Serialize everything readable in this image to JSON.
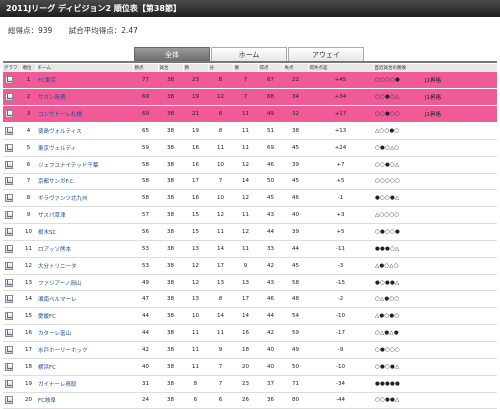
{
  "title": "2011Jリーグ ディビジョン2 順位表【第38節】",
  "summary": {
    "total_goals": "総得点：939",
    "avg_goals": "試合平均得点：2.47"
  },
  "tabs": [
    "全体",
    "ホーム",
    "アウェイ"
  ],
  "active_tab": 0,
  "columns": [
    "グラフ",
    "順位",
    "チーム",
    "勝点",
    "試合",
    "勝",
    "分",
    "敗",
    "得点",
    "失点",
    "得失点差",
    "直近試合の勝敗"
  ],
  "colors": {
    "promoted_row": "#f05a96",
    "title_bar": "#1f1f1f",
    "team_link": "#1a4fa0"
  },
  "rows": [
    {
      "rank": "1",
      "team": "FC東京",
      "pts": "77",
      "games": "38",
      "w": "23",
      "d": "8",
      "l": "7",
      "gf": "67",
      "ga": "22",
      "gd": "+45",
      "form": "○○○○●",
      "status": "J1昇格",
      "promoted": true
    },
    {
      "rank": "2",
      "team": "サガン鳥栖",
      "pts": "69",
      "games": "38",
      "w": "19",
      "d": "12",
      "l": "7",
      "gf": "68",
      "ga": "34",
      "gd": "+34",
      "form": "○○●○△",
      "status": "J1昇格",
      "promoted": true
    },
    {
      "rank": "3",
      "team": "コンサドーレ札幌",
      "pts": "69",
      "games": "38",
      "w": "21",
      "d": "6",
      "l": "11",
      "gf": "49",
      "ga": "32",
      "gd": "+17",
      "form": "○○●○○",
      "status": "J1昇格",
      "promoted": true
    },
    {
      "rank": "4",
      "team": "徳島ヴォルティス",
      "pts": "65",
      "games": "38",
      "w": "19",
      "d": "8",
      "l": "11",
      "gf": "51",
      "ga": "38",
      "gd": "+13",
      "form": "△○○●○",
      "status": "",
      "promoted": false
    },
    {
      "rank": "5",
      "team": "東京ヴェルディ",
      "pts": "59",
      "games": "38",
      "w": "16",
      "d": "11",
      "l": "11",
      "gf": "69",
      "ga": "45",
      "gd": "+24",
      "form": "○●○△○",
      "status": "",
      "promoted": false
    },
    {
      "rank": "6",
      "team": "ジェフユナイテッド千葉",
      "pts": "58",
      "games": "38",
      "w": "16",
      "d": "10",
      "l": "12",
      "gf": "46",
      "ga": "39",
      "gd": "+7",
      "form": "○○●○△",
      "status": "",
      "promoted": false
    },
    {
      "rank": "7",
      "team": "京都サンガF.C.",
      "pts": "58",
      "games": "38",
      "w": "17",
      "d": "7",
      "l": "14",
      "gf": "50",
      "ga": "45",
      "gd": "+5",
      "form": "○○○○○",
      "status": "",
      "promoted": false
    },
    {
      "rank": "8",
      "team": "ギラヴァンツ北九州",
      "pts": "58",
      "games": "38",
      "w": "16",
      "d": "10",
      "l": "12",
      "gf": "45",
      "ga": "46",
      "gd": "-1",
      "form": "●○○●△",
      "status": "",
      "promoted": false
    },
    {
      "rank": "9",
      "team": "ザスパ草津",
      "pts": "57",
      "games": "38",
      "w": "15",
      "d": "12",
      "l": "11",
      "gf": "43",
      "ga": "40",
      "gd": "+3",
      "form": "△○○○○",
      "status": "",
      "promoted": false
    },
    {
      "rank": "10",
      "team": "栃木SC",
      "pts": "56",
      "games": "38",
      "w": "15",
      "d": "11",
      "l": "12",
      "gf": "44",
      "ga": "39",
      "gd": "+5",
      "form": "○●○○●",
      "status": "",
      "promoted": false
    },
    {
      "rank": "11",
      "team": "ロアッソ熊本",
      "pts": "53",
      "games": "38",
      "w": "13",
      "d": "14",
      "l": "11",
      "gf": "33",
      "ga": "44",
      "gd": "-11",
      "form": "●●●○△",
      "status": "",
      "promoted": false
    },
    {
      "rank": "12",
      "team": "大分トリニータ",
      "pts": "53",
      "games": "38",
      "w": "12",
      "d": "17",
      "l": "9",
      "gf": "42",
      "ga": "45",
      "gd": "-3",
      "form": "△●○△○",
      "status": "",
      "promoted": false
    },
    {
      "rank": "13",
      "team": "ファジアーノ岡山",
      "pts": "49",
      "games": "38",
      "w": "12",
      "d": "13",
      "l": "13",
      "gf": "43",
      "ga": "58",
      "gd": "-15",
      "form": "●○●●△",
      "status": "",
      "promoted": false
    },
    {
      "rank": "14",
      "team": "湘南ベルマーレ",
      "pts": "47",
      "games": "38",
      "w": "13",
      "d": "8",
      "l": "17",
      "gf": "46",
      "ga": "48",
      "gd": "-2",
      "form": "○△●○○",
      "status": "",
      "promoted": false
    },
    {
      "rank": "15",
      "team": "愛媛FC",
      "pts": "44",
      "games": "38",
      "w": "10",
      "d": "14",
      "l": "14",
      "gf": "44",
      "ga": "54",
      "gd": "-10",
      "form": "△●○●○",
      "status": "",
      "promoted": false
    },
    {
      "rank": "16",
      "team": "カターレ富山",
      "pts": "44",
      "games": "38",
      "w": "11",
      "d": "11",
      "l": "16",
      "gf": "42",
      "ga": "59",
      "gd": "-17",
      "form": "○△●△●",
      "status": "",
      "promoted": false
    },
    {
      "rank": "17",
      "team": "水戸ホーリーホック",
      "pts": "42",
      "games": "38",
      "w": "11",
      "d": "9",
      "l": "18",
      "gf": "40",
      "ga": "49",
      "gd": "-9",
      "form": "○●○○○",
      "status": "",
      "promoted": false
    },
    {
      "rank": "18",
      "team": "横浜FC",
      "pts": "40",
      "games": "38",
      "w": "11",
      "d": "7",
      "l": "20",
      "gf": "40",
      "ga": "50",
      "gd": "-10",
      "form": "○●○●△",
      "status": "",
      "promoted": false
    },
    {
      "rank": "19",
      "team": "ガイナーレ鳥取",
      "pts": "31",
      "games": "38",
      "w": "8",
      "d": "7",
      "l": "23",
      "gf": "37",
      "ga": "71",
      "gd": "-34",
      "form": "●●●●●",
      "status": "",
      "promoted": false
    },
    {
      "rank": "20",
      "team": "FC岐阜",
      "pts": "24",
      "games": "38",
      "w": "6",
      "d": "6",
      "l": "26",
      "gf": "36",
      "ga": "80",
      "gd": "-44",
      "form": "○○●●△",
      "status": "",
      "promoted": false
    }
  ]
}
